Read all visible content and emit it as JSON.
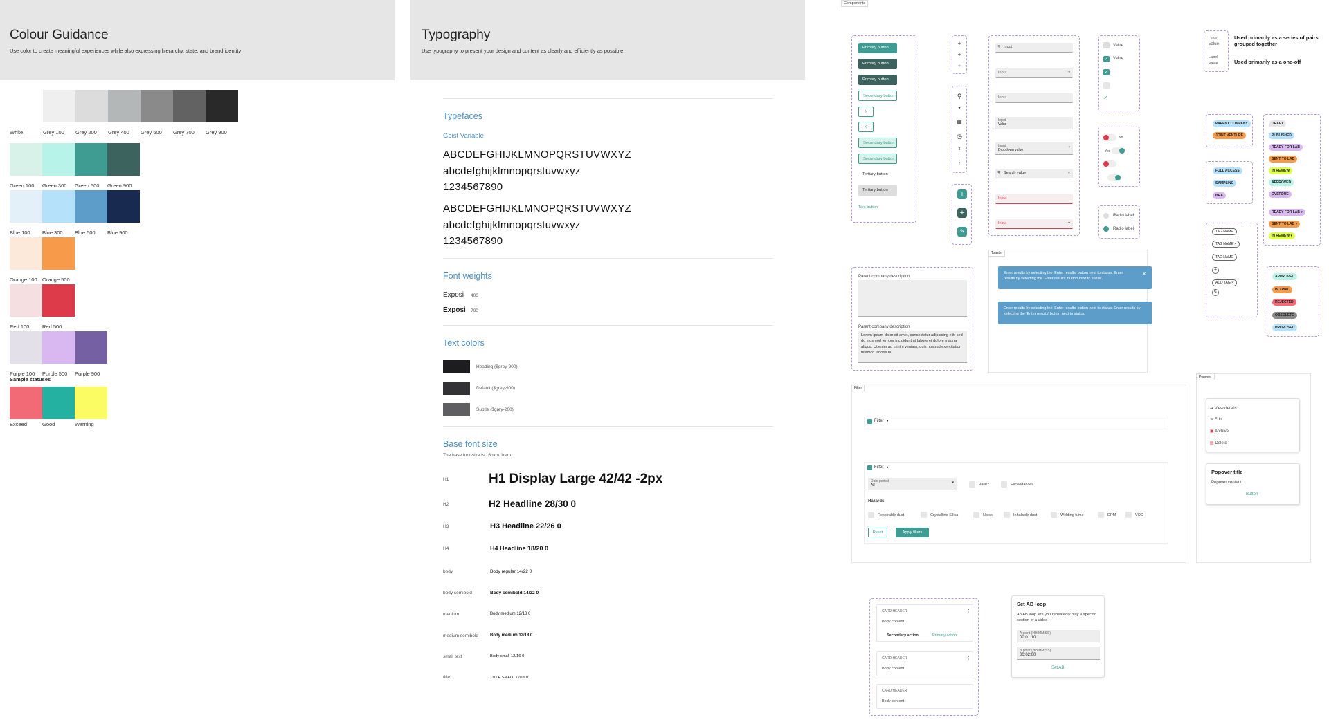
{
  "colour": {
    "title": "Colour Guidance",
    "subtitle": "Use color to create meaningful experiences while also expressing hierarchy, state, and brand identity",
    "greys": [
      {
        "name": "White",
        "hex": "#ffffff"
      },
      {
        "name": "Grey 100",
        "hex": "#efefef"
      },
      {
        "name": "Grey 200",
        "hex": "#dcdcdc"
      },
      {
        "name": "Grey 400",
        "hex": "#b3b7b8"
      },
      {
        "name": "Grey 600",
        "hex": "#8a8a8a"
      },
      {
        "name": "Grey 700",
        "hex": "#626262"
      },
      {
        "name": "Grey 900",
        "hex": "#292929"
      }
    ],
    "greens": [
      {
        "name": "Green 100",
        "hex": "#d8f2ea"
      },
      {
        "name": "Green 300",
        "hex": "#b8f3ea"
      },
      {
        "name": "Green 500",
        "hex": "#3e9c93"
      },
      {
        "name": "Green 900",
        "hex": "#3c635d"
      }
    ],
    "blues": [
      {
        "name": "Blue 100",
        "hex": "#e3eff9"
      },
      {
        "name": "Blue 300",
        "hex": "#b6e1fb"
      },
      {
        "name": "Blue 500",
        "hex": "#5c9ec9"
      },
      {
        "name": "Blue 900",
        "hex": "#182a50"
      }
    ],
    "oranges": [
      {
        "name": "Orange 100",
        "hex": "#fde9d9"
      },
      {
        "name": "Orange 500",
        "hex": "#f79b4b"
      }
    ],
    "reds": [
      {
        "name": "Red 100",
        "hex": "#f6dfe0"
      },
      {
        "name": "Red 500",
        "hex": "#dd3b4a"
      }
    ],
    "purples": [
      {
        "name": "Purple 100",
        "hex": "#e3e0ea"
      },
      {
        "name": "Purple 500",
        "hex": "#d9b8f1"
      },
      {
        "name": "Purple 900",
        "hex": "#7460a3"
      }
    ],
    "sample_label": "Sample statuses",
    "statuses": [
      {
        "name": "Exceed",
        "hex": "#f36a77"
      },
      {
        "name": "Good",
        "hex": "#24b1a2"
      },
      {
        "name": "Warning",
        "hex": "#fbfb64"
      }
    ]
  },
  "typo": {
    "title": "Typography",
    "subtitle": "Use typography to present your design and content as clearly and efficiently as possible.",
    "typefaces_label": "Typefaces",
    "font_name": "Geist Variable",
    "upper": "ABCDEFGHIJKLMNOPQRSTUVWXYZ",
    "lower": "abcdefghijklmnopqrstuvwxyz",
    "digits": "1234567890",
    "weights_label": "Font weights",
    "weights": [
      {
        "name": "Exposi",
        "value": "400"
      },
      {
        "name": "Exposi",
        "value": "700"
      }
    ],
    "colors_label": "Text colors",
    "text_colors": [
      {
        "label": "Heading ($grey-900)",
        "hex": "#1d1d1f"
      },
      {
        "label": "Default ($grey-900)",
        "hex": "#333336"
      },
      {
        "label": "Subtle ($grey-200)",
        "hex": "#5f5f62"
      }
    ],
    "base_label": "Base font size",
    "base_note": "The base font-size is 16px = 1rem",
    "scale": [
      {
        "tag": "H1",
        "text": "H1 Display Large  42/42 -2px"
      },
      {
        "tag": "H2",
        "text": "H2 Headline 28/30 0"
      },
      {
        "tag": "H3",
        "text": "H3 Headline 22/26 0"
      },
      {
        "tag": "H4",
        "text": "H4 Headline 18/20 0"
      },
      {
        "tag": "body",
        "text": "Body regular 14/22 0"
      },
      {
        "tag": "body semibold",
        "text": "Body semibold 14/22 0"
      },
      {
        "tag": "medium",
        "text": "Body medium 12/18 0"
      },
      {
        "tag": "medium semibold",
        "text": "Body medium 12/18 0"
      },
      {
        "tag": "small text",
        "text": "Body small 12/16 0"
      },
      {
        "tag": "title",
        "text": "TITLE SMALL 12/16 0"
      }
    ]
  },
  "comp": {
    "frame_label": "Components",
    "buttons": [
      {
        "label": "Primary button",
        "style": "p1"
      },
      {
        "label": "Primary button",
        "style": "p2"
      },
      {
        "label": "Primary button",
        "style": "p2"
      },
      {
        "label": "Secondary button",
        "style": "s1"
      },
      {
        "label": "Secondary button",
        "style": "s2"
      },
      {
        "label": "Secondary button",
        "style": "s2"
      },
      {
        "label": "Tertiary button",
        "style": "t1"
      },
      {
        "label": "Tertiary button",
        "style": "t2"
      },
      {
        "label": "Text button",
        "style": "tx"
      }
    ],
    "inputs": {
      "i1": "Input",
      "i2": "Input",
      "i3": "Input",
      "i4_label": "Input",
      "i4_value": "Value",
      "i5_label": "Input",
      "i5_value": "Dropdown value",
      "i6": "Search value",
      "i7": "Input",
      "i8": "Input"
    },
    "checks": {
      "c1": "Value",
      "c2": "Value"
    },
    "toggles": {
      "no": "No",
      "yes": "Yes"
    },
    "radios": {
      "r1": "Radio label",
      "r2": "Radio label"
    },
    "pairs": {
      "label1": "Label",
      "value1": "Value",
      "label2": "Label",
      "value2": "Value",
      "note1": "Used primarily as a series of pairs grouped together",
      "note2": "Used primarily as a one-off"
    },
    "chips_a": [
      "PARENT COMPANY",
      "JOINT VENTURE"
    ],
    "chips_b": [
      "FULL ACCESS",
      "SAMPLING",
      "HRA"
    ],
    "chips_c": [
      "DRAFT",
      "PUBLISHED",
      "READY FOR LAB",
      "SENT TO LAB",
      "IN REVIEW",
      "APPROVED",
      "OVERDUE"
    ],
    "chips_d": [
      "READY FOR LAB",
      "SENT TO LAB",
      "IN REVIEW"
    ],
    "chips_e": [
      "APPROVED",
      "IN TRIAL",
      "REJECTED",
      "OBSOLETE",
      "PROPOSED"
    ],
    "tags": [
      "TAG NAME",
      "TAG NAME",
      "TAG NAME",
      "ADD TAG"
    ],
    "textarea": {
      "label1": "Parent company description",
      "label2": "Parent company description",
      "value": "Lorem ipsum dolor sit amet, consectetur adipiscing elit, sed do eiusmod tempor incididunt ut labore et dolore magna aliqua. Ut enim ad minim veniam, quis nostrud exercitation ullamco laboris ni"
    },
    "toaster": {
      "label": "Toaster",
      "msg": "Enter results by selecting the 'Enter results' button next to status. Enter results by selecting the 'Enter results' button next to status."
    },
    "filter": {
      "label": "Filter",
      "toggle": "Filter",
      "date_label": "Date period",
      "date_value": "All",
      "valid": "Valid?",
      "exceed": "Exceedances",
      "hazards": "Hazards:",
      "hazard_items": [
        "Respirable dust",
        "Crystalline Silica",
        "Noise",
        "Inhalable dust",
        "Welding fume",
        "DPM",
        "VOC"
      ],
      "reset": "Reset",
      "apply": "Apply filters"
    },
    "popover": {
      "label": "Popover",
      "items": [
        "View details",
        "Edit",
        "Archive",
        "Delete"
      ],
      "title": "Popover title",
      "content": "Popover content",
      "button": "Button"
    },
    "cards": [
      {
        "header": "CARD HEADER",
        "body": "Body content",
        "secondary": "Secondary action",
        "primary": "Primary action"
      },
      {
        "header": "CARD HEADER",
        "body": "Body content"
      },
      {
        "header": "CARD HEADER",
        "body": "Body content"
      }
    ],
    "ab": {
      "title": "Set AB loop",
      "desc": "An AB loop lets you repeatedly play a specific section of a video",
      "a_label": "A point (HH:MM:SS)",
      "a_value": "00:01:10",
      "b_label": "B point (HH:MM:SS)",
      "b_value": "00:02:00",
      "button": "Set AB"
    }
  }
}
